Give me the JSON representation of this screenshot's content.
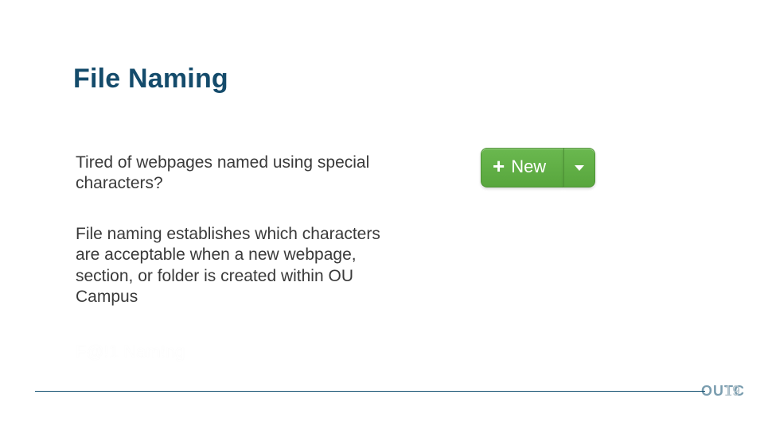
{
  "slide": {
    "title": "File Naming",
    "paragraph1": "Tired of webpages named using special characters?",
    "paragraph2": "File naming establishes which characters are acceptable when a new webpage, section, or folder is created within OU Campus",
    "file_example": "F@!1 Nam!ng"
  },
  "button": {
    "label": "New",
    "plus_glyph": "+"
  },
  "footer": {
    "logo": "OUTC",
    "page_number": "19"
  }
}
